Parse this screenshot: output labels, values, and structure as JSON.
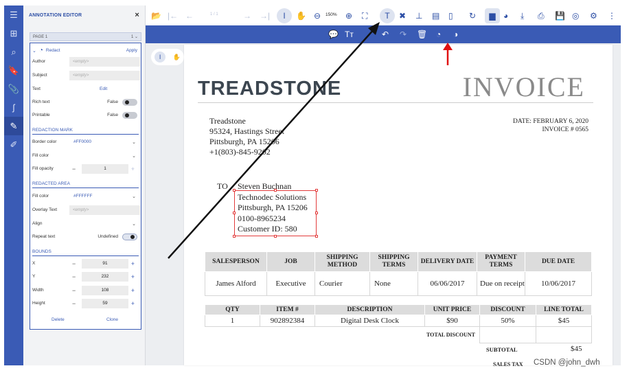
{
  "panel": {
    "title": "ANNOTATION EDITOR",
    "close": "×",
    "page_select": "PAGE 1",
    "page_num": "1",
    "annotation_type": "Redact",
    "apply": "Apply",
    "author_label": "Author",
    "author_placeholder": "<empty>",
    "subject_label": "Subject",
    "subject_placeholder": "<empty>",
    "text_label": "Text",
    "text_edit": "Edit",
    "rich_text_label": "Rich text",
    "rich_text_value": "False",
    "printable_label": "Printable",
    "printable_value": "False",
    "redaction_mark_section": "REDACTION MARK",
    "border_color_label": "Border color",
    "border_color_value": "#FF0000",
    "fill_color_label": "Fill color",
    "fill_opacity_label": "Fill opacity",
    "fill_opacity_value": "1",
    "redacted_area_section": "REDACTED AREA",
    "area_fill_color_label": "Fill color",
    "area_fill_color_value": "#FFFFFF",
    "overlay_text_label": "Overlay Text",
    "overlay_text_placeholder": "<empty>",
    "align_label": "Align",
    "repeat_text_label": "Repeat text",
    "repeat_text_value": "Undefined",
    "bounds_section": "BOUNDS",
    "x_label": "X",
    "x_value": "91",
    "y_label": "Y",
    "y_value": "232",
    "width_label": "Width",
    "width_value": "108",
    "height_label": "Height",
    "height_value": "59",
    "delete": "Delete",
    "clone": "Clone"
  },
  "toolbar": {
    "page_info": "1 / 1",
    "zoom": "150%"
  },
  "invoice": {
    "brand": "TREADSTONE",
    "title": "INVOICE",
    "from_lines": [
      "Treadstone",
      "95324, Hastings Street",
      "Pittsburgh, PA 15206",
      "+1(803)-845-9202"
    ],
    "date": "DATE: FEBRUARY 6, 2020",
    "invoice_no": "INVOICE # 0565",
    "to_label": "TO",
    "to_lines": [
      "Steven Buchnan",
      "Technodec Solutions",
      "Pittsburgh, PA 15206",
      "0100-8965234",
      "Customer ID: 580"
    ],
    "table1_headers": [
      "SALESPERSON",
      "JOB",
      "SHIPPING METHOD",
      "SHIPPING TERMS",
      "DELIVERY DATE",
      "PAYMENT TERMS",
      "DUE DATE"
    ],
    "table1_row": [
      "James Alford",
      "Executive",
      "Courier",
      "None",
      "06/06/2017",
      "Due on receipt",
      "10/06/2017"
    ],
    "table2_headers": [
      "QTY",
      "ITEM #",
      "DESCRIPTION",
      "UNIT PRICE",
      "DISCOUNT",
      "LINE TOTAL"
    ],
    "table2_row": [
      "1",
      "902892384",
      "Digital Desk Clock",
      "$90",
      "50%",
      "$45"
    ],
    "total_discount": "TOTAL DISCOUNT",
    "subtotal_label": "SUBTOTAL",
    "subtotal_value": "$45",
    "sales_tax_label": "SALES TAX"
  },
  "watermark": "CSDN @john_dwh",
  "colors": {
    "accent": "#3a5bb5",
    "redact_border": "#e23b3b",
    "arrow_black": "#111111",
    "arrow_red": "#e01010"
  }
}
